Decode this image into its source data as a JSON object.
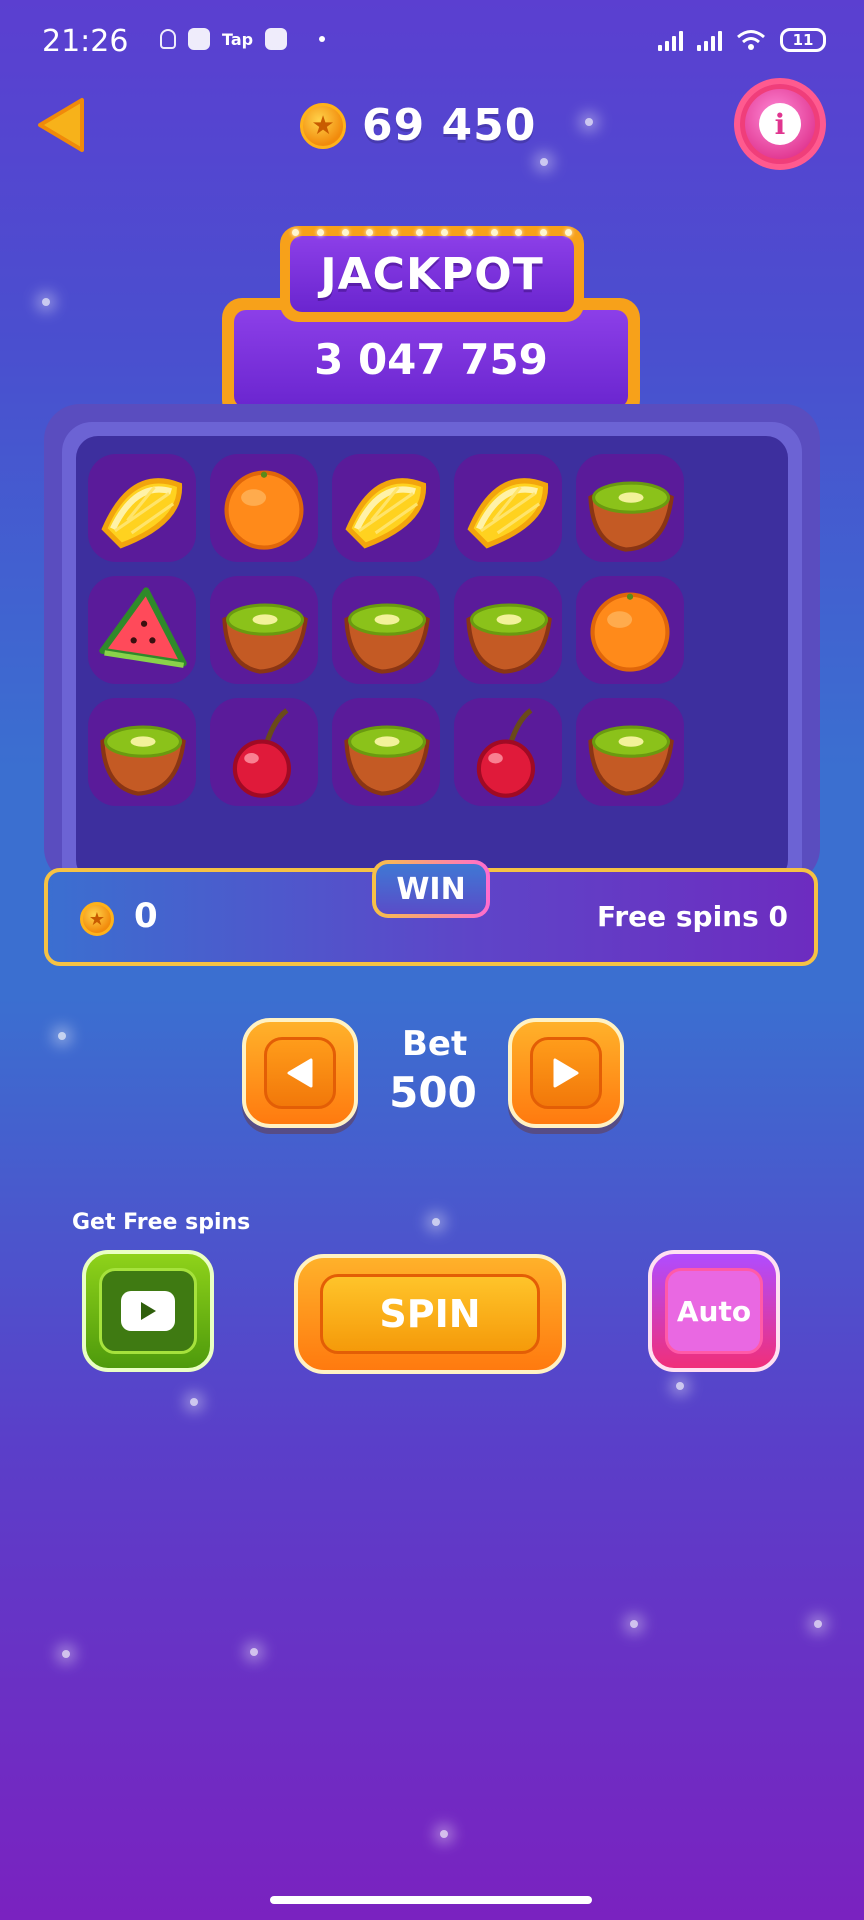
{
  "status": {
    "time": "21:26",
    "tap_label": "Tap",
    "battery": "11"
  },
  "header": {
    "coins": "69 450"
  },
  "jackpot": {
    "title": "JACKPOT",
    "value": "3 047 759"
  },
  "reels": [
    [
      "lemon",
      "orange",
      "lemon",
      "lemon",
      "kiwi"
    ],
    [
      "watermelon",
      "kiwi",
      "kiwi",
      "kiwi",
      "orange"
    ],
    [
      "kiwi",
      "cherry",
      "kiwi",
      "cherry",
      "kiwi"
    ]
  ],
  "win": {
    "tab_label": "WIN",
    "amount": "0",
    "free_spins_text": "Free spins 0"
  },
  "bet": {
    "label": "Bet",
    "value": "500"
  },
  "controls": {
    "free_spins_label": "Get Free spins",
    "spin_label": "SPIN",
    "auto_label": "Auto"
  },
  "colors": {
    "accent_orange": "#ff7a0f",
    "jackpot_purple": "#6a25cf",
    "win_border": "#f6c244"
  }
}
